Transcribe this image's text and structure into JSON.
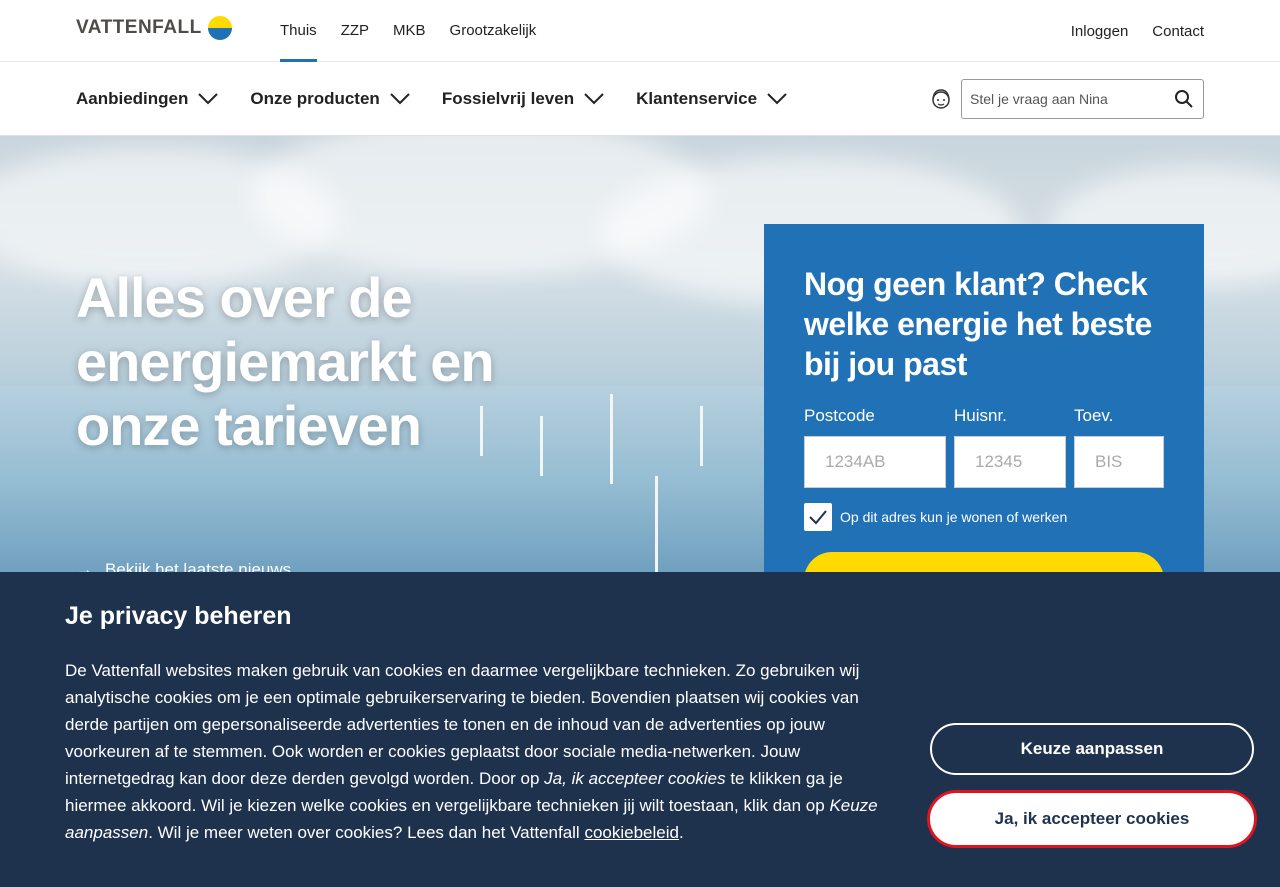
{
  "brand": {
    "name": "VATTENFALL",
    "colors": {
      "blue": "#2071b5",
      "yellow": "#ffda00",
      "navy": "#1e324e"
    }
  },
  "topnav": {
    "items": [
      "Thuis",
      "ZZP",
      "MKB",
      "Grootzakelijk"
    ],
    "active": "Thuis",
    "right_links": [
      "Inloggen",
      "Contact"
    ]
  },
  "mainnav": {
    "items": [
      "Aanbiedingen",
      "Onze producten",
      "Fossielvrij leven",
      "Klantenservice"
    ],
    "search_placeholder": "Stel je vraag aan Nina"
  },
  "hero": {
    "title": "Alles over de energiemarkt en onze tarieven",
    "link_label": "Bekijk het laatste nieuws"
  },
  "form": {
    "heading": "Nog geen klant? Check welke energie het beste bij jou past",
    "postcode_label": "Postcode",
    "postcode_placeholder": "1234AB",
    "huisnr_label": "Huisnr.",
    "huisnr_placeholder": "12345",
    "toev_label": "Toev.",
    "toev_placeholder": "BIS",
    "checkbox_label": "Op dit adres kun je wonen of werken",
    "checkbox_checked": true
  },
  "cookie": {
    "title": "Je privacy beheren",
    "text_1": "De Vattenfall websites maken gebruik van cookies en daarmee vergelijkbare technieken. Zo gebruiken wij analytische cookies om je een optimale gebruikerservaring te bieden. Bovendien plaatsen wij cookies van derde partijen om gepersonaliseerde advertenties te tonen en de inhoud van de advertenties op jouw voorkeuren af te stemmen. Ook worden er cookies geplaatst door sociale media-netwerken. Jouw internetgedrag kan door deze derden gevolgd worden. Door op ",
    "text_em_1": "Ja, ik accepteer cookies",
    "text_2": " te klikken ga je hiermee akkoord. Wil je kiezen welke cookies en vergelijkbare technieken jij wilt toestaan, klik dan op ",
    "text_em_2": "Keuze aanpassen",
    "text_3": ". Wil je meer weten over cookies? Lees dan het Vattenfall ",
    "policy_link": "cookiebeleid",
    "text_4": ".",
    "customize_label": "Keuze aanpassen",
    "accept_label": "Ja, ik accepteer cookies"
  }
}
